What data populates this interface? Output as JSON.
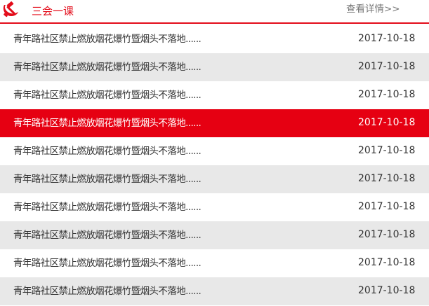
{
  "header": {
    "icon": "party-emblem-icon",
    "title": "三会一课",
    "more_link": "查看详情>>",
    "accent_color": "#e30c1a"
  },
  "list": {
    "highlight_color": "#e60012",
    "stripe_color": "#e8e8e8",
    "items": [
      {
        "title": "青年路社区禁止燃放烟花爆竹暨烟头不落地......",
        "date": "2017-10-18",
        "active": false
      },
      {
        "title": "青年路社区禁止燃放烟花爆竹暨烟头不落地......",
        "date": "2017-10-18",
        "active": false
      },
      {
        "title": "青年路社区禁止燃放烟花爆竹暨烟头不落地......",
        "date": "2017-10-18",
        "active": false
      },
      {
        "title": "青年路社区禁止燃放烟花爆竹暨烟头不落地......",
        "date": "2017-10-18",
        "active": true
      },
      {
        "title": "青年路社区禁止燃放烟花爆竹暨烟头不落地......",
        "date": "2017-10-18",
        "active": false
      },
      {
        "title": "青年路社区禁止燃放烟花爆竹暨烟头不落地......",
        "date": "2017-10-18",
        "active": false
      },
      {
        "title": "青年路社区禁止燃放烟花爆竹暨烟头不落地......",
        "date": "2017-10-18",
        "active": false
      },
      {
        "title": "青年路社区禁止燃放烟花爆竹暨烟头不落地......",
        "date": "2017-10-18",
        "active": false
      },
      {
        "title": "青年路社区禁止燃放烟花爆竹暨烟头不落地......",
        "date": "2017-10-18",
        "active": false
      },
      {
        "title": "青年路社区禁止燃放烟花爆竹暨烟头不落地......",
        "date": "2017-10-18",
        "active": false
      }
    ]
  }
}
